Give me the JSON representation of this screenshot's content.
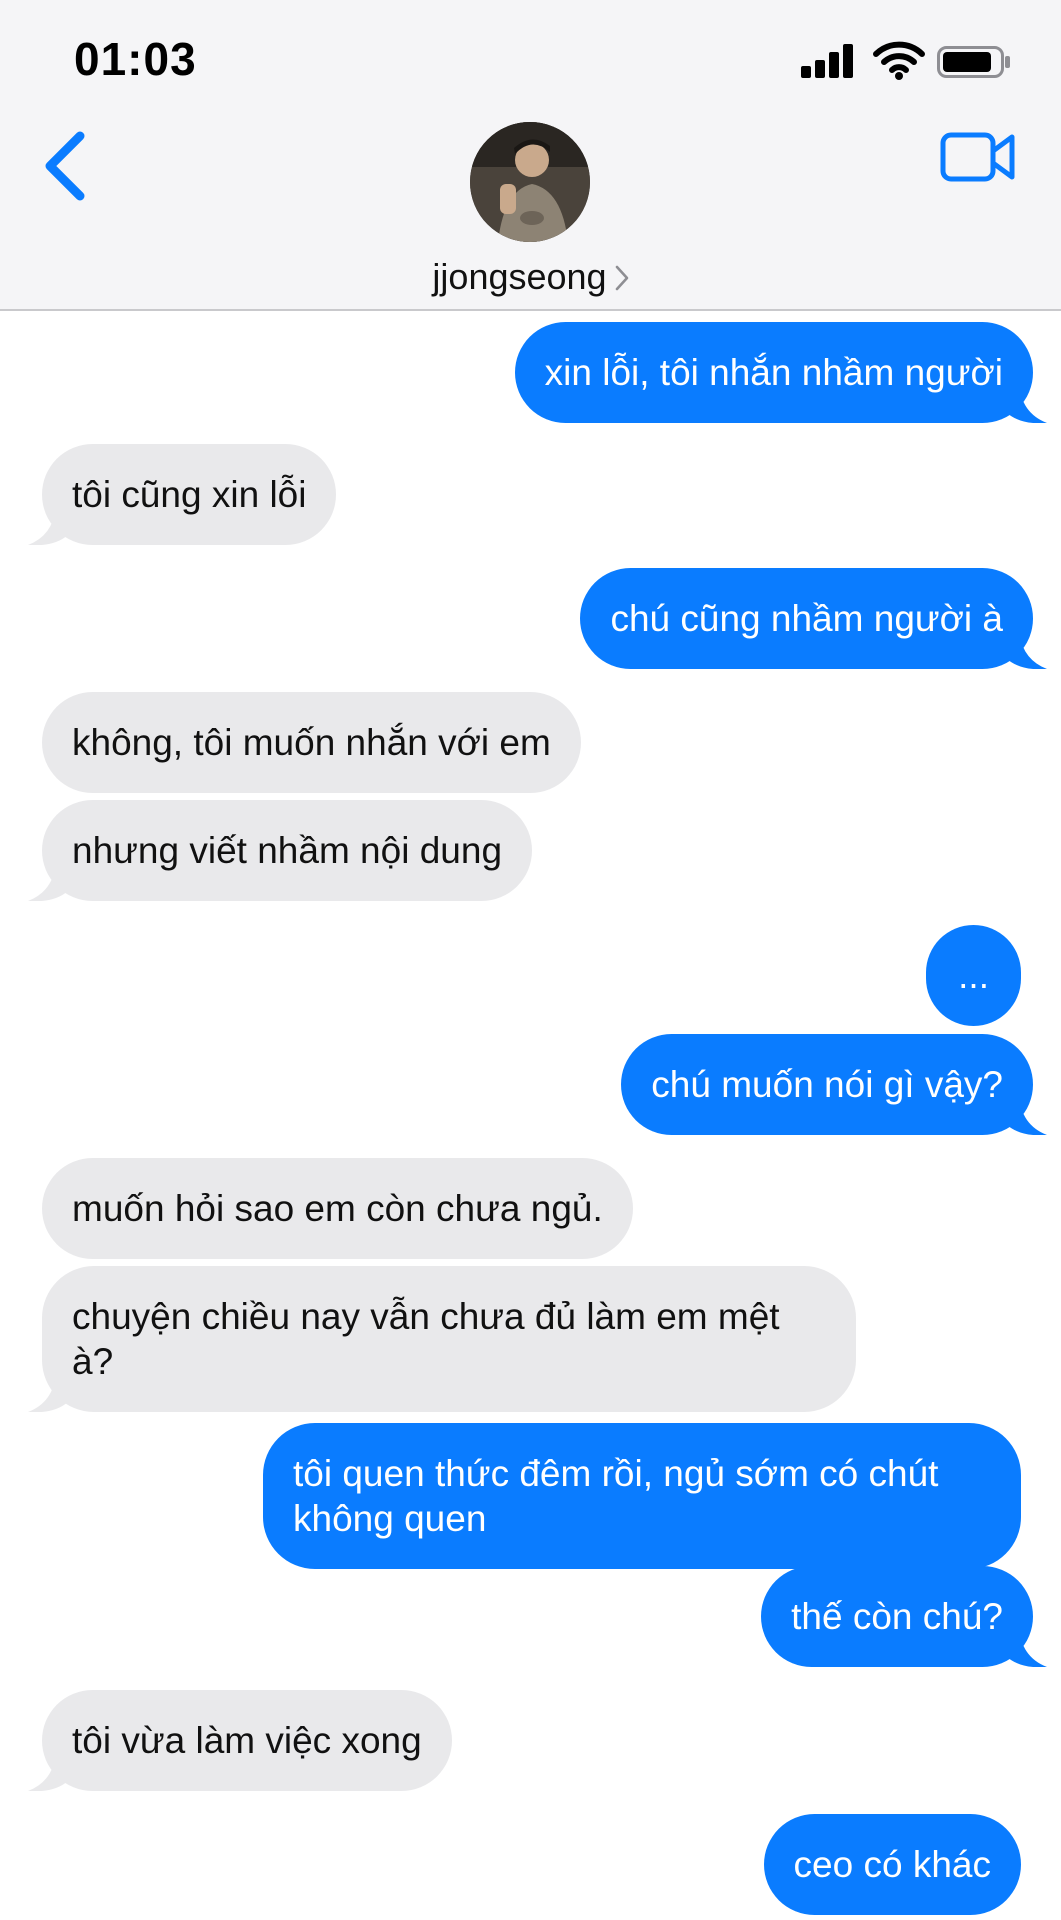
{
  "status_bar": {
    "time": "01:03"
  },
  "header": {
    "contact_name": "jjongseong"
  },
  "colors": {
    "outgoing": "#0a7cff",
    "incoming": "#e9e9eb",
    "accent": "#0a7cff"
  },
  "icons": [
    "chevron-left-icon",
    "video-camera-icon",
    "signal-icon",
    "wifi-icon",
    "battery-icon"
  ],
  "messages": [
    {
      "from": "me",
      "text": "xin lỗi, tôi nhắn nhầm người"
    },
    {
      "from": "them",
      "text": "tôi cũng xin lỗi"
    },
    {
      "from": "me",
      "text": "chú cũng nhầm người à"
    },
    {
      "from": "them",
      "text": "không, tôi muốn nhắn với em"
    },
    {
      "from": "them",
      "text": "nhưng viết nhầm nội dung"
    },
    {
      "from": "me",
      "text": "..."
    },
    {
      "from": "me",
      "text": "chú muốn nói gì vậy?"
    },
    {
      "from": "them",
      "text": "muốn hỏi sao em còn chưa ngủ."
    },
    {
      "from": "them",
      "text": "chuyện chiều nay vẫn chưa đủ làm em mệt à?"
    },
    {
      "from": "me",
      "text": "tôi quen thức đêm rồi, ngủ sớm có chút không quen"
    },
    {
      "from": "me",
      "text": "thế còn chú?"
    },
    {
      "from": "them",
      "text": "tôi vừa làm việc xong"
    },
    {
      "from": "me",
      "text": "ceo có khác"
    }
  ]
}
